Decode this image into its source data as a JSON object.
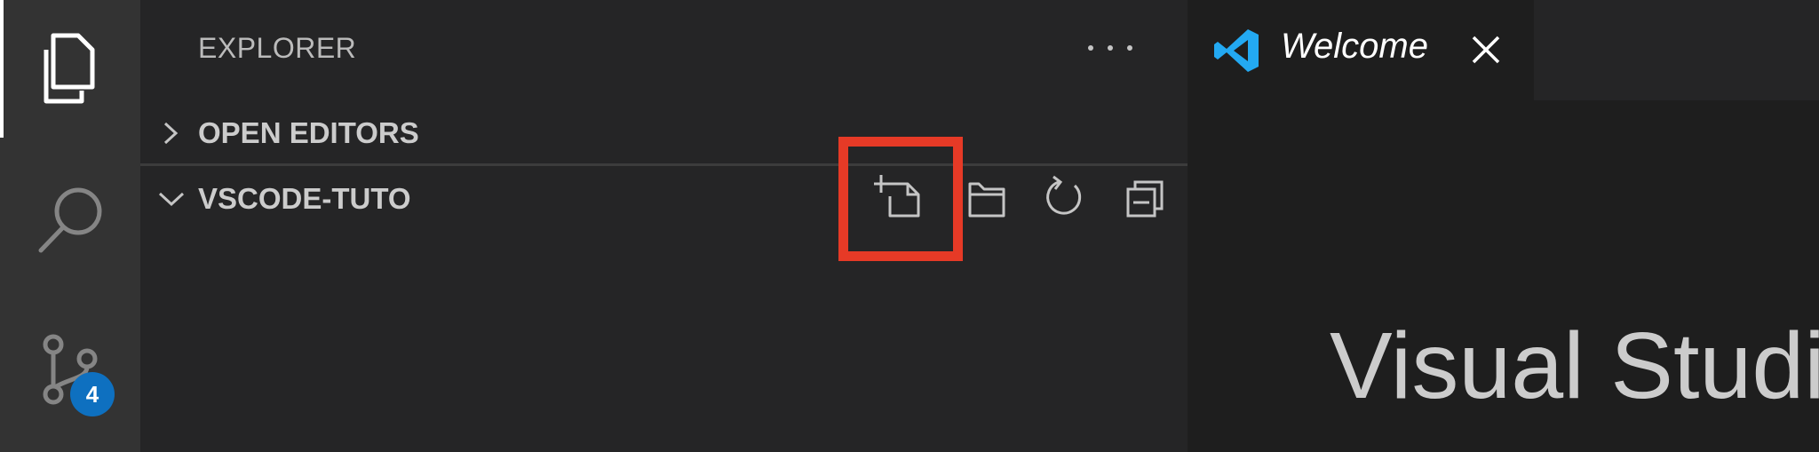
{
  "activity_bar": {
    "items": [
      {
        "icon": "files-icon",
        "active": true
      },
      {
        "icon": "search-icon",
        "active": false
      },
      {
        "icon": "source-control-icon",
        "active": false,
        "badge": "4"
      }
    ],
    "badge_color": "#0e70c0"
  },
  "sidebar": {
    "title": "EXPLORER",
    "more_icon": "more-actions-icon",
    "sections": [
      {
        "label": "OPEN EDITORS",
        "expanded": false
      },
      {
        "label": "VSCODE-TUTO",
        "expanded": true
      }
    ],
    "toolbar": [
      {
        "icon": "new-file-icon",
        "highlighted": true
      },
      {
        "icon": "new-folder-icon",
        "highlighted": false
      },
      {
        "icon": "refresh-icon",
        "highlighted": false
      },
      {
        "icon": "collapse-all-icon",
        "highlighted": false
      }
    ],
    "highlight_color": "#e63a26"
  },
  "editor": {
    "tabs": [
      {
        "label": "Welcome",
        "icon": "vscode-logo-icon",
        "close_icon": "close-icon"
      }
    ],
    "welcome_heading": "Visual Studio"
  },
  "colors": {
    "accent_blue": "#0e70c0",
    "logo_blue": "#23a9f2"
  }
}
